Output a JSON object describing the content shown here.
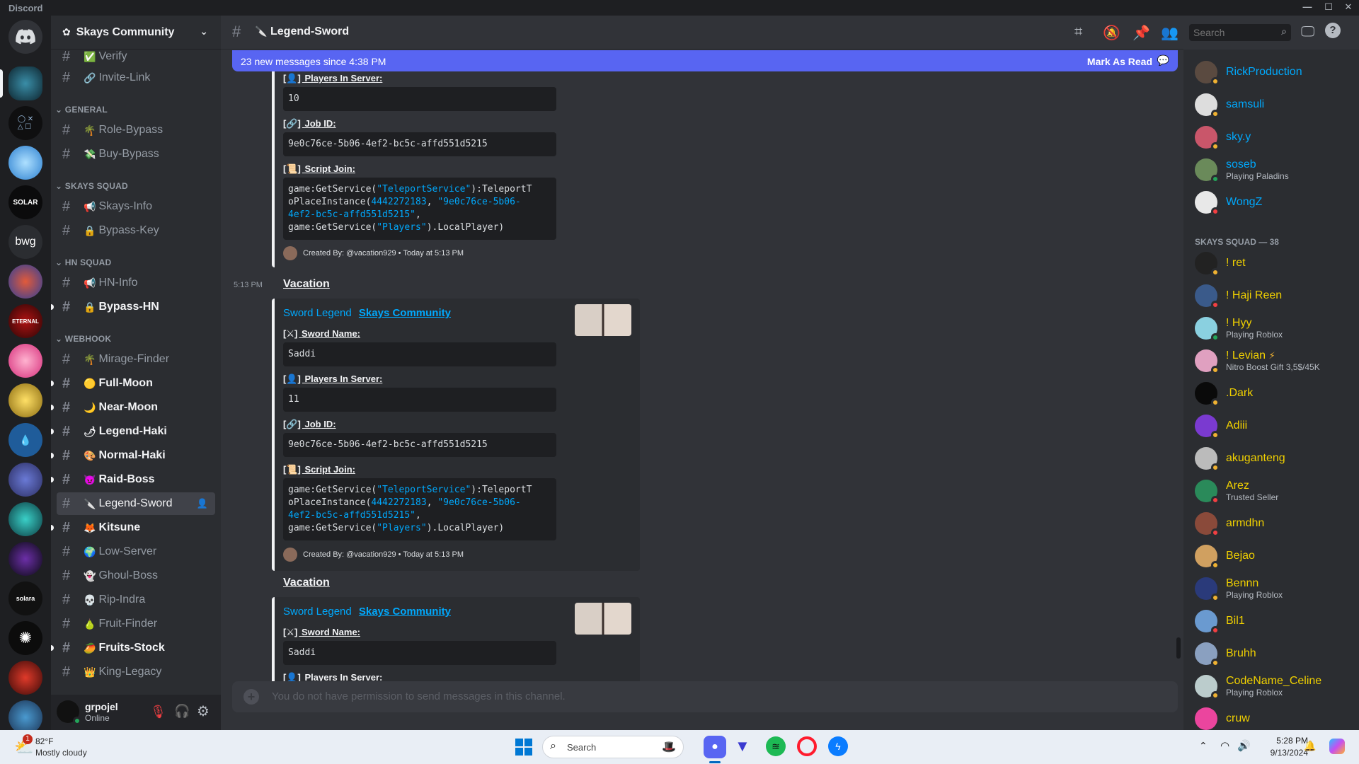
{
  "window": {
    "title": "Discord"
  },
  "server": {
    "name": "Skays Community"
  },
  "rail_servers": [
    {
      "label": ""
    },
    {
      "label": ""
    },
    {
      "label": ""
    },
    {
      "label": "SOLAR"
    },
    {
      "label": "bwg"
    }
  ],
  "sidebar": {
    "top_channels": [
      {
        "emoji": "✅",
        "label": "Verify"
      },
      {
        "emoji": "🔗",
        "label": "Invite-Link"
      }
    ],
    "categories": [
      {
        "label": "GENERAL",
        "channels": [
          {
            "emoji": "🌴",
            "label": "Role-Bypass"
          },
          {
            "emoji": "💸",
            "label": "Buy-Bypass"
          }
        ]
      },
      {
        "label": "SKAYS SQUAD",
        "channels": [
          {
            "emoji": "📢",
            "label": "Skays-Info"
          },
          {
            "emoji": "🔒",
            "label": "Bypass-Key"
          }
        ]
      },
      {
        "label": "HN SQUAD",
        "channels": [
          {
            "emoji": "📢",
            "label": "HN-Info"
          },
          {
            "emoji": "🔒",
            "label": "Bypass-HN"
          }
        ]
      },
      {
        "label": "WEBHOOK",
        "channels": [
          {
            "emoji": "🌴",
            "label": "Mirage-Finder"
          },
          {
            "emoji": "🟡",
            "label": "Full-Moon"
          },
          {
            "emoji": "🌙",
            "label": "Near-Moon"
          },
          {
            "emoji": "🌶",
            "label": "Legend-Haki"
          },
          {
            "emoji": "🎨",
            "label": "Normal-Haki"
          },
          {
            "emoji": "👿",
            "label": "Raid-Boss"
          },
          {
            "emoji": "🔪",
            "label": "Legend-Sword"
          },
          {
            "emoji": "🦊",
            "label": "Kitsune"
          },
          {
            "emoji": "🌍",
            "label": "Low-Server"
          },
          {
            "emoji": "👻",
            "label": "Ghoul-Boss"
          },
          {
            "emoji": "💀",
            "label": "Rip-Indra"
          },
          {
            "emoji": "🍐",
            "label": "Fruit-Finder"
          },
          {
            "emoji": "🥭",
            "label": "Fruits-Stock"
          },
          {
            "emoji": "👑",
            "label": "King-Legacy"
          }
        ]
      }
    ]
  },
  "user": {
    "name": "grpojel",
    "status": "Online"
  },
  "channel": {
    "name": "Legend-Sword",
    "emoji": "🔪"
  },
  "header": {
    "search_placeholder": "Search"
  },
  "new_messages": {
    "text": "23 new messages since 4:38 PM",
    "action": "Mark As Read"
  },
  "first_embed": {
    "players_label": "Players In Server:",
    "players": "10",
    "jobid_label": "Job ID:",
    "jobid": "9e0c76ce-5b06-4ef2-bc5c-affd551d5215",
    "script_label": "Script Join:",
    "footer": "Created By: @vacation929 • Today at 5:13 PM"
  },
  "messages": [
    {
      "time": "5:13 PM",
      "author": "Vacation",
      "title_a": "Sword Legend",
      "title_b": "Skays Community",
      "sword_label": "Sword Name:",
      "sword": "Saddi",
      "players_label": "Players In Server:",
      "players": "11",
      "jobid_label": "Job ID:",
      "jobid": "9e0c76ce-5b06-4ef2-bc5c-affd551d5215",
      "script_label": "Script Join:",
      "footer": "Created By: @vacation929 • Today at 5:13 PM"
    },
    {
      "author": "Vacation",
      "title_a": "Sword Legend",
      "title_b": "Skays Community",
      "sword_label": "Sword Name:",
      "sword": "Saddi",
      "players_label": "Players In Server:"
    }
  ],
  "script": {
    "l1a": "game:GetService(",
    "l1b": "\"TeleportService\"",
    "l1c": "):TeleportT",
    "l2a": "oPlaceInstance(",
    "l2b": "4442272183",
    "l2c": ", ",
    "l2d": "\"9e0c76ce-5b06-",
    "l3a": "4ef2-bc5c-affd551d5215\"",
    "l3b": ",",
    "l4a": "game:GetService(",
    "l4b": "\"Players\"",
    "l4c": ").LocalPlayer)"
  },
  "composer": {
    "placeholder": "You do not have permission to send messages in this channel."
  },
  "members": {
    "top": [
      {
        "name": "RickProduction",
        "sub": "",
        "color": "#00a8fc"
      },
      {
        "name": "samsuli",
        "sub": "",
        "color": "#00a8fc"
      },
      {
        "name": "sky.y",
        "sub": "",
        "color": "#00a8fc"
      },
      {
        "name": "soseb",
        "sub": "Playing Paladins",
        "color": "#00a8fc"
      },
      {
        "name": "WongZ",
        "sub": "",
        "color": "#00a8fc"
      }
    ],
    "category": "SKAYS SQUAD — 38",
    "squad": [
      {
        "name": "! ret",
        "sub": "",
        "color": "#f0d000"
      },
      {
        "name": "! Haji Reen",
        "sub": "",
        "color": "#f0d000"
      },
      {
        "name": "! Hyy",
        "sub": "Playing Roblox",
        "color": "#f0d000"
      },
      {
        "name": "! Levian",
        "sub": "Nitro Boost Gift 3,5$/45K",
        "color": "#f0d000"
      },
      {
        "name": ".Dark",
        "sub": "",
        "color": "#f0d000"
      },
      {
        "name": "Adiii",
        "sub": "",
        "color": "#f0d000"
      },
      {
        "name": "akuganteng",
        "sub": "",
        "color": "#f0d000"
      },
      {
        "name": "Arez",
        "sub": "Trusted Seller",
        "color": "#f0d000"
      },
      {
        "name": "armdhn",
        "sub": "",
        "color": "#f0d000"
      },
      {
        "name": "Bejao",
        "sub": "",
        "color": "#f0d000"
      },
      {
        "name": "Bennn",
        "sub": "Playing Roblox",
        "color": "#f0d000"
      },
      {
        "name": "Bil1",
        "sub": "",
        "color": "#f0d000"
      },
      {
        "name": "Bruhh",
        "sub": "",
        "color": "#f0d000"
      },
      {
        "name": "CodeName_Celine",
        "sub": "Playing Roblox",
        "color": "#f0d000"
      },
      {
        "name": "cruw",
        "sub": "",
        "color": "#f0d000"
      }
    ]
  },
  "taskbar": {
    "temp": "82°F",
    "weather": "Mostly cloudy",
    "badge": "1",
    "search": "Search",
    "time": "5:28 PM",
    "date": "9/13/2024"
  }
}
